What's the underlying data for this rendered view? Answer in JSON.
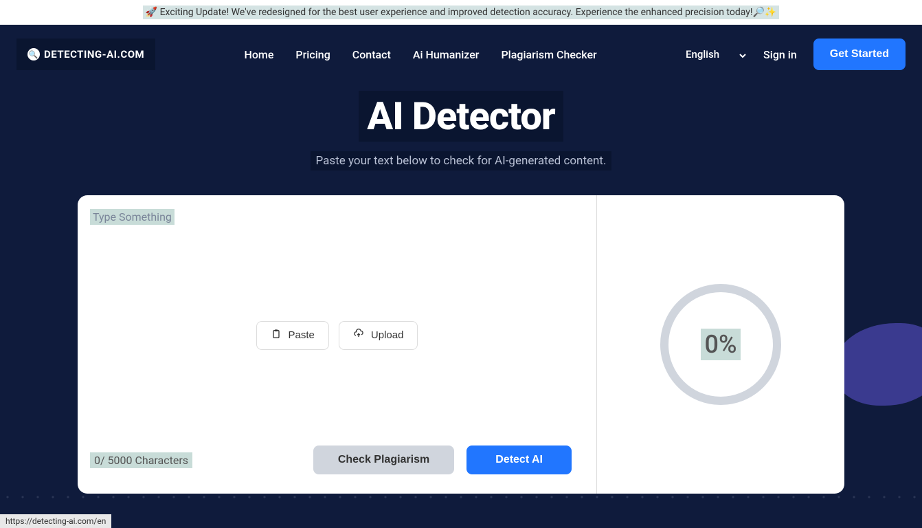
{
  "banner": {
    "text": "🚀 Exciting Update! We've redesigned for the best user experience and improved detection accuracy. Experience the enhanced precision today!🔎✨"
  },
  "logo": {
    "text": "DETECTING-AI.COM"
  },
  "nav": {
    "home": "Home",
    "pricing": "Pricing",
    "contact": "Contact",
    "humanizer": "Ai Humanizer",
    "plagiarism": "Plagiarism Checker"
  },
  "header": {
    "language": "English",
    "signin": "Sign in",
    "get_started": "Get Started"
  },
  "hero": {
    "title": "AI Detector",
    "subtitle": "Paste your text below to check for AI-generated content."
  },
  "editor": {
    "placeholder": "Type Something",
    "paste": "Paste",
    "upload": "Upload",
    "char_count": "0/ 5000 Characters",
    "check_plagiarism": "Check Plagiarism",
    "detect_ai": "Detect AI"
  },
  "gauge": {
    "percent": "0%"
  },
  "status_url": "https://detecting-ai.com/en"
}
